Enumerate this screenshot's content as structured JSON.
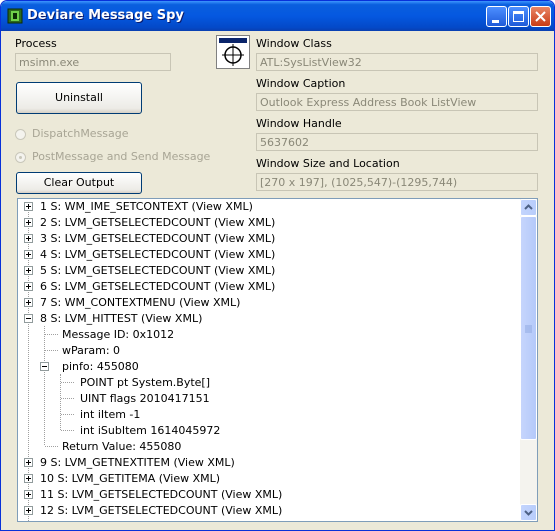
{
  "window": {
    "title": "Deviare Message Spy"
  },
  "process": {
    "label": "Process",
    "value": "msimn.exe"
  },
  "buttons": {
    "uninstall": "Uninstall",
    "clear_output": "Clear Output"
  },
  "options": {
    "dispatch": "DispatchMessage",
    "post_send": "PostMessage and Send Message",
    "selected": "post_send"
  },
  "window_info": {
    "class_label": "Window Class",
    "class_value": "ATL:SysListView32",
    "caption_label": "Window Caption",
    "caption_value": "Outlook Express Address Book ListView",
    "handle_label": "Window Handle",
    "handle_value": "5637602",
    "size_label": "Window Size and Location",
    "size_value": "[270 x 197], (1025,547)-(1295,744)"
  },
  "tree": [
    "1 S: WM_IME_SETCONTEXT (View XML)",
    "2 S: LVM_GETSELECTEDCOUNT (View XML)",
    "3 S: LVM_GETSELECTEDCOUNT (View XML)",
    "4 S: LVM_GETSELECTEDCOUNT (View XML)",
    "5 S: LVM_GETSELECTEDCOUNT (View XML)",
    "6 S: LVM_GETSELECTEDCOUNT (View XML)",
    "7 S: WM_CONTEXTMENU (View XML)",
    "8 S: LVM_HITTEST (View XML)",
    "Message ID: 0x1012",
    "wParam: 0",
    "pinfo: 455080",
    "POINT pt System.Byte[]",
    "UINT flags 2010417151",
    "int iItem -1",
    "int iSubItem 1614045972",
    "Return Value: 455080",
    "9 S: LVM_GETNEXTITEM (View XML)",
    "10 S: LVM_GETITEMA (View XML)",
    "11 S: LVM_GETSELECTEDCOUNT (View XML)",
    "12 S: LVM_GETSELECTEDCOUNT (View XML)"
  ],
  "colors": {
    "title_bar": "#0558e0",
    "window_bg": "#ece9d8",
    "close_button": "#c93c16"
  }
}
